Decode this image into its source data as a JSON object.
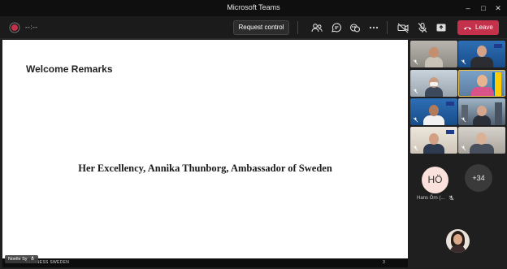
{
  "window": {
    "title": "Microsoft Teams",
    "minimize_glyph": "–",
    "maximize_glyph": "□",
    "close_glyph": "✕"
  },
  "toolbar": {
    "timer": "--:--",
    "request_control_label": "Request control",
    "leave_label": "Leave",
    "icons": [
      "people-icon",
      "chat-icon",
      "reactions-icon",
      "more-icon",
      "camera-off-icon",
      "mic-off-icon",
      "share-icon"
    ],
    "leave_color": "#c4314b"
  },
  "slide": {
    "heading": "Welcome Remarks",
    "body": "Her Excellency, Annika Thunborg, Ambassador of Sweden",
    "footer_text": "BUSINESS SWEDEN",
    "page_number": "3"
  },
  "presenter": {
    "name": "Noelle Sy"
  },
  "participants": {
    "more_count": "+34",
    "hans_initials": "HÖ",
    "hans_name": "Hans Örn (..."
  },
  "colors": {
    "titlebar": "#0f0f0f",
    "toolbar": "#1b1b1b",
    "background": "#1f1f1f",
    "stage": "#ffffff",
    "accent_selected": "#f2c14e"
  }
}
